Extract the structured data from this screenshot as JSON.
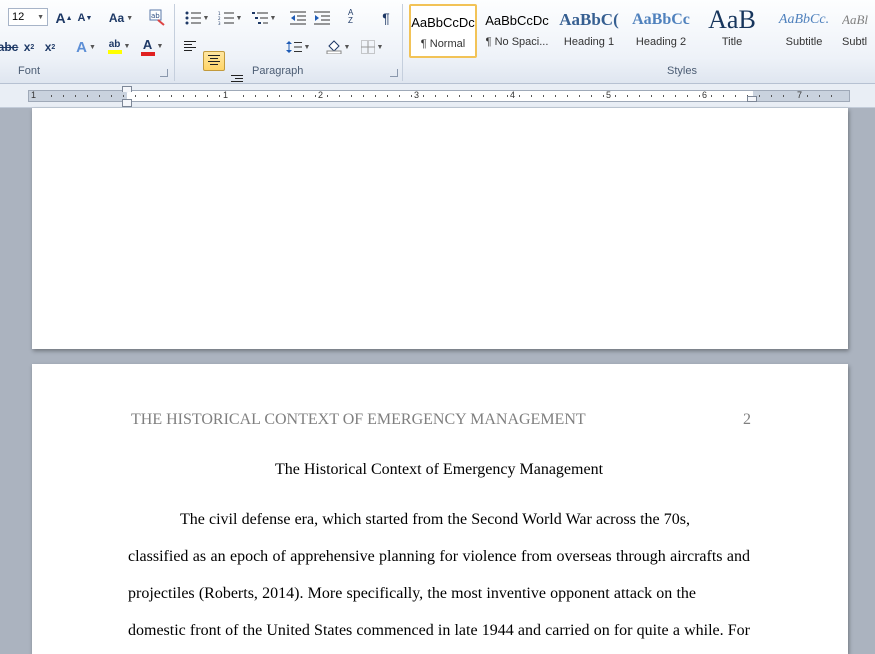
{
  "ribbon": {
    "font_size_value": "12",
    "groups": {
      "font_label": "Font",
      "paragraph_label": "Paragraph",
      "styles_label": "Styles"
    },
    "font_buttons": {
      "grow": "A",
      "shrink": "A",
      "change_case": "Aa",
      "strike": "abc",
      "subscript": "x",
      "superscript": "x",
      "text_effects": "A",
      "highlight": "ab",
      "font_color": "A"
    },
    "paragraph_buttons": {
      "pilcrow": "¶",
      "sort": "A Z"
    },
    "styles": [
      {
        "sample": "AaBbCcDc",
        "name": "¶ Normal"
      },
      {
        "sample": "AaBbCcDc",
        "name": "¶ No Spaci..."
      },
      {
        "sample": "AaBbC(",
        "name": "Heading 1"
      },
      {
        "sample": "AaBbCc",
        "name": "Heading 2"
      },
      {
        "sample": "AaB",
        "name": "Title"
      },
      {
        "sample": "AaBbCc.",
        "name": "Subtitle"
      },
      {
        "sample": "AaBl",
        "name": "Subtl"
      }
    ],
    "colors": {
      "heading_blue": "#365f91",
      "heading2_blue": "#4f81bd",
      "title_color": "#17365d",
      "subtitle_color": "#4f81bd",
      "highlight_yellow": "#ffff00",
      "font_red": "#e02020"
    }
  },
  "ruler": {
    "numbers": [
      "1",
      "1",
      "2",
      "3",
      "4",
      "5",
      "6",
      "7"
    ]
  },
  "document": {
    "running_head": "THE HISTORICAL CONTEXT OF EMERGENCY MANAGEMENT",
    "page_number": "2",
    "title": "The Historical Context of Emergency Management",
    "body_lines": [
      "The civil defense era, which started from the Second World War across the 70s,",
      "classified as an epoch of apprehensive planning for violence from overseas through aircrafts and",
      "projectiles (Roberts, 2014). More specifically, the most inventive opponent attack on the",
      "domestic front of the United States commenced in late 1944 and carried on for quite a while. For"
    ]
  }
}
